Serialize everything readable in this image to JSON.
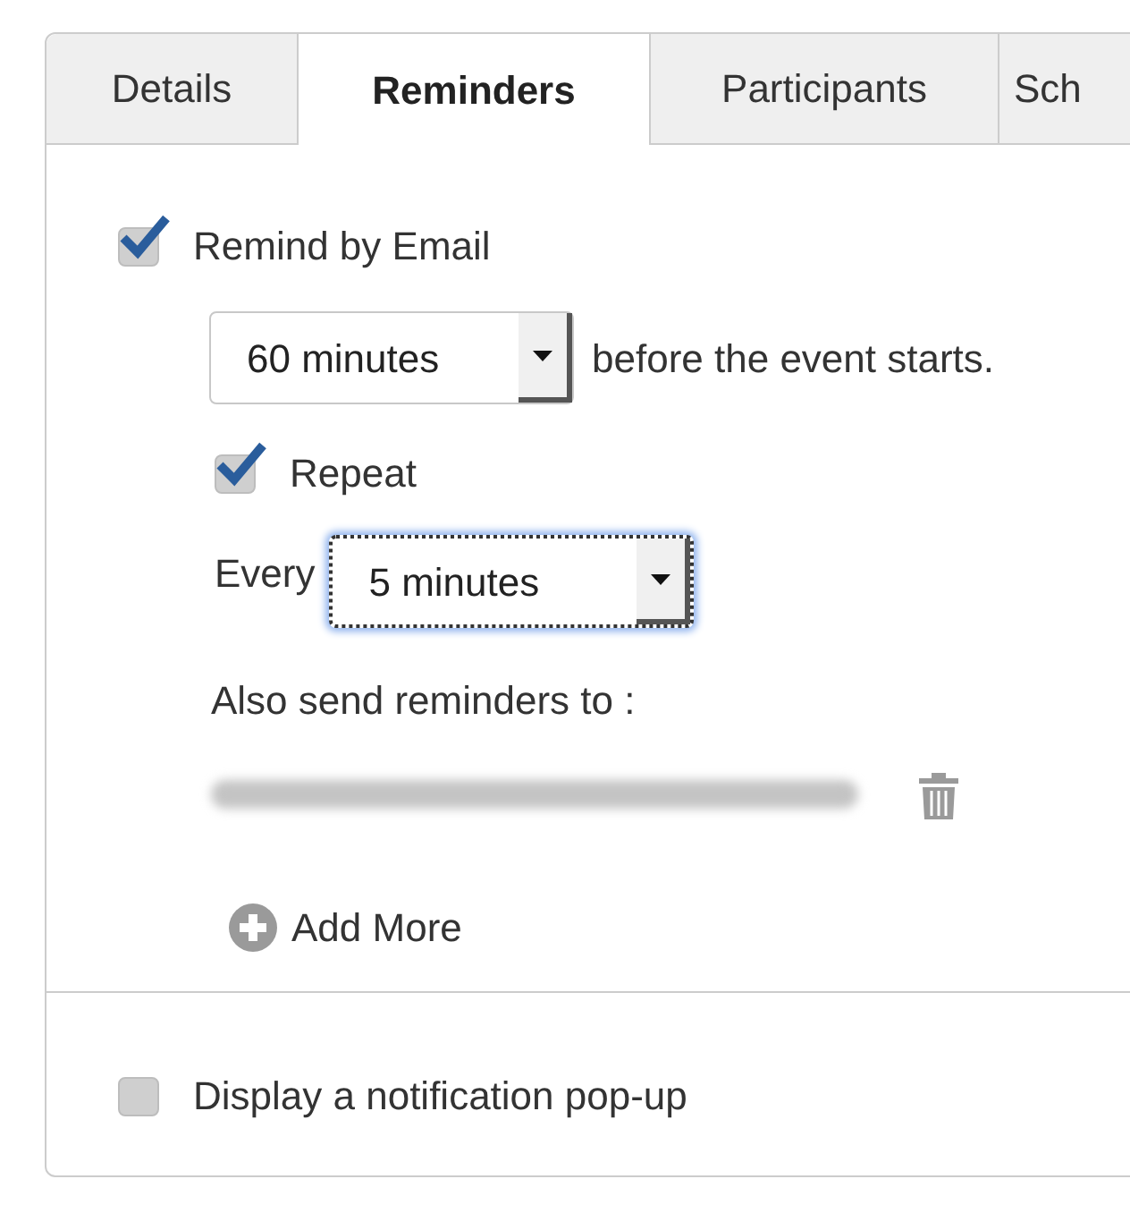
{
  "tabs": [
    {
      "label": "Details",
      "selected": false
    },
    {
      "label": "Reminders",
      "selected": true
    },
    {
      "label": "Participants",
      "selected": false
    },
    {
      "label": "Sch",
      "selected": false
    }
  ],
  "email_reminder": {
    "label": "Remind by Email",
    "checked": true,
    "lead_time": {
      "value": "60 minutes",
      "suffix": "before the event starts."
    },
    "repeat": {
      "label": "Repeat",
      "checked": true
    },
    "interval": {
      "label": "Every",
      "value": "5 minutes",
      "focused": true
    },
    "also_send_label": "Also send reminders to :",
    "recipients": [
      {
        "kind": "redacted"
      }
    ],
    "add_more": "Add More"
  },
  "popup_reminder": {
    "label": "Display a notification pop-up",
    "checked": false
  }
}
